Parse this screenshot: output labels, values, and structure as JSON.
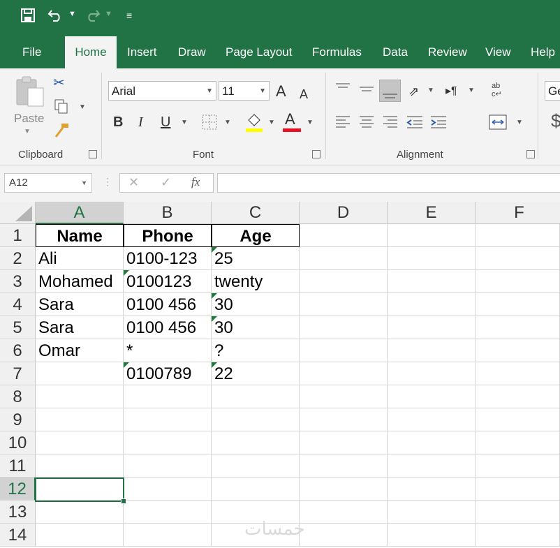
{
  "tabs": [
    "File",
    "Home",
    "Insert",
    "Draw",
    "Page Layout",
    "Formulas",
    "Data",
    "Review",
    "View",
    "Help"
  ],
  "active_tab": "Home",
  "ribbon": {
    "clipboard": {
      "label": "Clipboard",
      "paste": "Paste"
    },
    "font": {
      "label": "Font",
      "name": "Arial",
      "size": "11",
      "bold": "B",
      "italic": "I",
      "underline": "U",
      "grow": "A",
      "shrink": "A",
      "color_letter": "A"
    },
    "alignment": {
      "label": "Alignment"
    },
    "number": {
      "format_partial": "Ge",
      "currency_partial": "$"
    }
  },
  "formula_bar": {
    "name_box": "A12",
    "cancel": "✕",
    "enter": "✓",
    "fx": "fx",
    "value": ""
  },
  "columns": [
    "A",
    "B",
    "C",
    "D",
    "E",
    "F"
  ],
  "rows": [
    "1",
    "2",
    "3",
    "4",
    "5",
    "6",
    "7",
    "8",
    "9",
    "10",
    "11",
    "12",
    "13",
    "14"
  ],
  "selected_cell": "A12",
  "cells": {
    "A1": "Name",
    "B1": "Phone",
    "C1": "Age",
    "A2": " Ali",
    "B2": "0100-123",
    "C2": "25",
    "A3": "Mohamed",
    "B3": "0100123",
    "C3": "twenty",
    "A4": "Sara",
    "B4": "0100 456",
    "C4": "30",
    "A5": "Sara",
    "B5": "0100 456",
    "C5": "30",
    "A6": "Omar",
    "B6": "*",
    "C6": "?",
    "A7": "",
    "B7": "0100789",
    "C7": "22"
  },
  "watermark": "خمسات",
  "colors": {
    "accent": "#217346",
    "font_color_bar": "#e81123",
    "highlight_bar": "#ffff00"
  }
}
